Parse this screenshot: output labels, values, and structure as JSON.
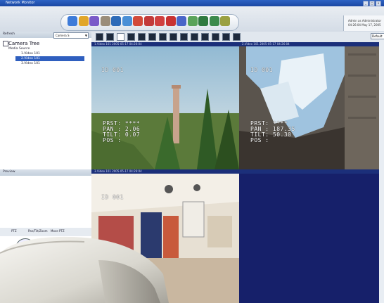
{
  "window": {
    "title": "Network Monitor",
    "controls": [
      "_",
      "□",
      "x"
    ]
  },
  "toolbar": {
    "icons": [
      "eye-icon",
      "folder-icon",
      "chart-icon",
      "tools-icon",
      "monitor-icon",
      "camera-icon",
      "grid-icon",
      "alarm-icon",
      "record-icon",
      "mute-icon",
      "dvd-icon",
      "export-icon",
      "user-icon",
      "users-icon",
      "settings-icon"
    ],
    "status": {
      "line1": "Admin as Administrator",
      "line2": "04:26:04 May 17, 2005"
    }
  },
  "left_panel": {
    "refresh_label": "Refresh",
    "camera_select": "Camera S",
    "tree_title": "Camera Tree",
    "tree_root": "Media Source",
    "tree_items": [
      "1.Video 101",
      "2.Video 101",
      "3.Video 101"
    ],
    "selected_index": 1,
    "preview_label": "Preview",
    "control_tabs": [
      "PTZ",
      "Pan/Tilt/Zoom",
      "Move PTZ"
    ]
  },
  "layout_bar": {
    "zoom_select": "Default"
  },
  "video_panes": [
    {
      "title": "1.Video 101   2005-05-17 04:26:04",
      "osd_top": "ID 001",
      "osd_lines": [
        "PRST: ****",
        "PAN : 2.06",
        "TILT: 0.07",
        "POS :"
      ]
    },
    {
      "title": "2.Video 101   2005-05-17 04:26:04",
      "osd_top": "ID 001",
      "osd_lines": [
        "PRST: ****",
        "PAN : 187.35",
        "TILT: 50.30",
        "POS :"
      ]
    },
    {
      "title": "3.Video 101   2005-05-17 04:26:04",
      "osd_top": "ID 001",
      "osd_lines": []
    },
    {
      "title": "",
      "osd_top": "",
      "osd_lines": []
    }
  ]
}
